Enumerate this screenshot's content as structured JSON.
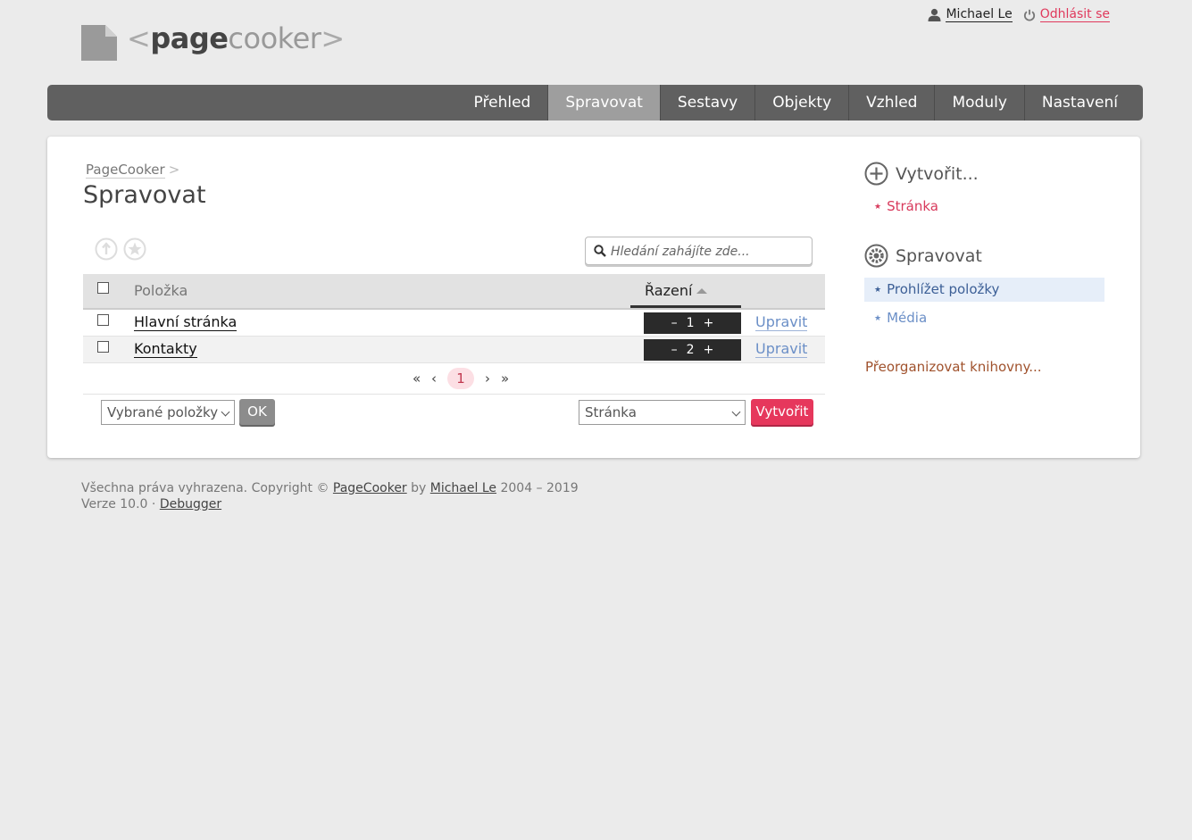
{
  "logo": {
    "bracket_open": "<",
    "text_bold": "page",
    "text_light": "cooker",
    "bracket_close": ">"
  },
  "user": {
    "name": "Michael Le",
    "logout": "Odhlásit se"
  },
  "nav": {
    "items": [
      {
        "label": "Přehled"
      },
      {
        "label": "Spravovat"
      },
      {
        "label": "Sestavy"
      },
      {
        "label": "Objekty"
      },
      {
        "label": "Vzhled"
      },
      {
        "label": "Moduly"
      },
      {
        "label": "Nastavení"
      }
    ],
    "active": "Spravovat"
  },
  "main": {
    "breadcrumb": {
      "link": "PageCooker",
      "separator": ">"
    },
    "title": "Spravovat",
    "search": {
      "placeholder": "Hledání zahájíte zde..."
    },
    "table": {
      "headers": {
        "item": "Položka",
        "order": "Řazení"
      },
      "rows": [
        {
          "name": "Hlavní stránka",
          "order": "1",
          "minus": "–",
          "plus": "+",
          "edit": "Upravit"
        },
        {
          "name": "Kontakty",
          "order": "2",
          "minus": "–",
          "plus": "+",
          "edit": "Upravit"
        }
      ]
    },
    "pager": {
      "first": "«",
      "prev": "‹",
      "current": "1",
      "next": "›",
      "last": "»"
    },
    "bulk": {
      "select_value": "Vybrané položky",
      "ok": "OK"
    },
    "create": {
      "select_value": "Stránka",
      "button": "Vytvořit"
    }
  },
  "sidebar": {
    "create": {
      "heading": "Vytvořit...",
      "items": [
        {
          "label": "Stránka"
        }
      ]
    },
    "manage": {
      "heading": "Spravovat",
      "items": [
        {
          "label": "Prohlížet položky"
        },
        {
          "label": "Média"
        }
      ]
    },
    "reorganize": "Přeorganizovat knihovny..."
  },
  "footer": {
    "rights": "Všechna práva vyhrazena. Copyright ©",
    "product": "PageCooker",
    "by": "by",
    "author": "Michael Le",
    "years": "2004 – 2019",
    "version": "Verze 10.0",
    "dot": "·",
    "debugger": "Debugger"
  },
  "colors": {
    "accent": "#e6375c",
    "nav_bg": "#606060",
    "nav_active": "#9e9e9e",
    "link_blue": "#6b8fc7",
    "link_brown": "#a0522d"
  }
}
